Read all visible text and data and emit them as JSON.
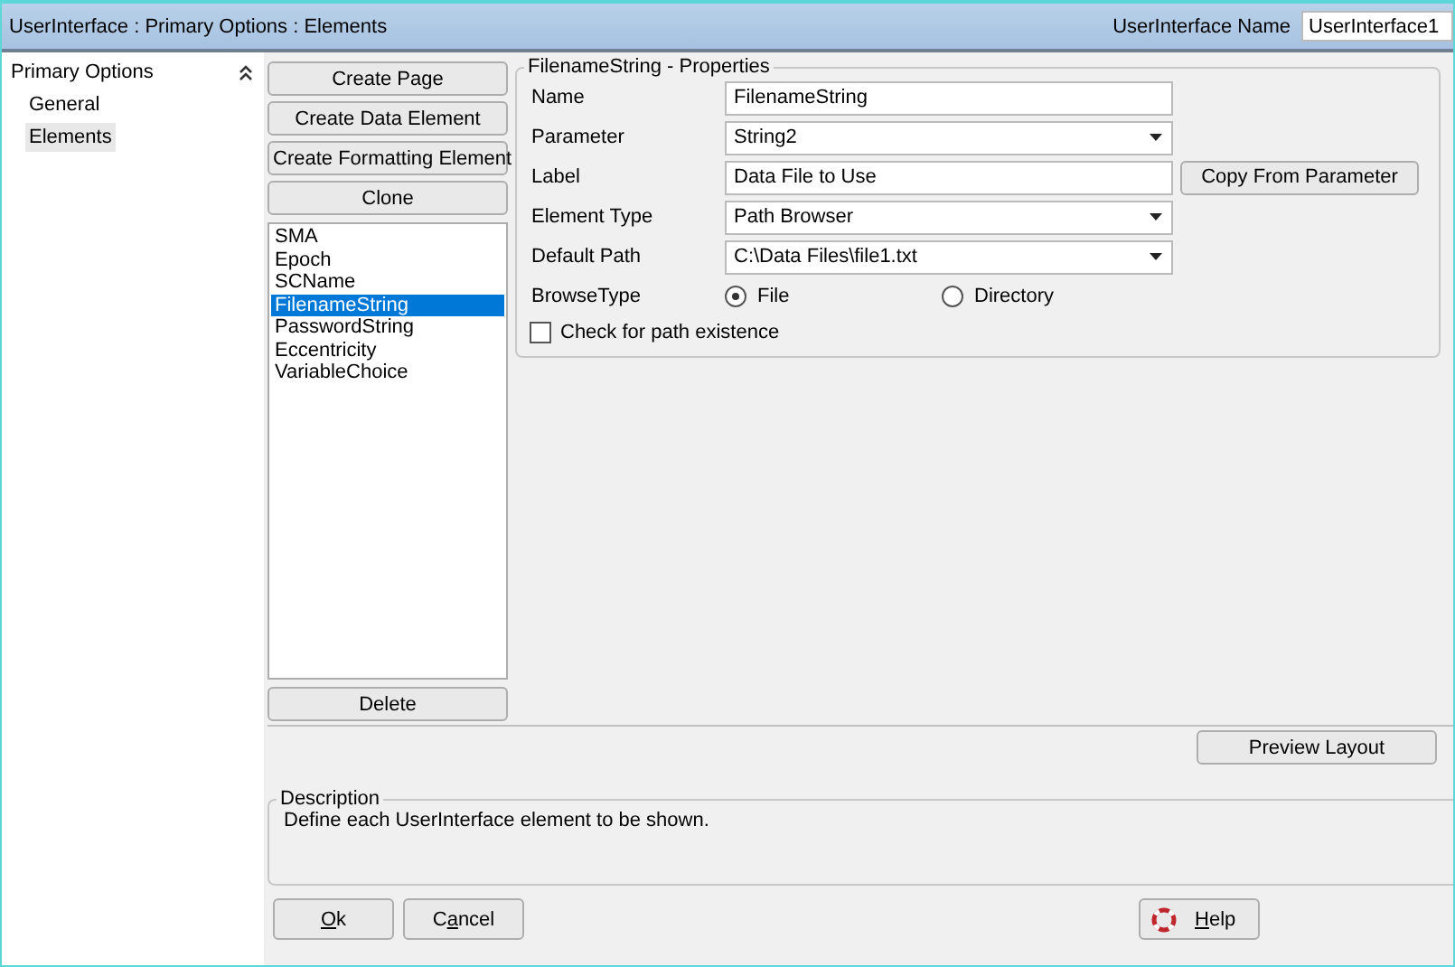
{
  "window": {
    "title": "UserInterface : Primary Options : Elements",
    "name_label": "UserInterface Name",
    "name_value": "UserInterface1"
  },
  "sidebar": {
    "title": "Primary Options",
    "expanded": true,
    "items": [
      {
        "label": "General",
        "selected": false
      },
      {
        "label": "Elements",
        "selected": true
      }
    ]
  },
  "actions": [
    "Create Page",
    "Create Data Element",
    "Create Formatting Element",
    "Clone"
  ],
  "elements": [
    {
      "label": "SMA",
      "selected": false
    },
    {
      "label": "Epoch",
      "selected": false
    },
    {
      "label": "SCName",
      "selected": false
    },
    {
      "label": "FilenameString",
      "selected": true
    },
    {
      "label": "PasswordString",
      "selected": false
    },
    {
      "label": "Eccentricity",
      "selected": false
    },
    {
      "label": "VariableChoice",
      "selected": false
    }
  ],
  "delete_button": "Delete",
  "properties": {
    "title": "FilenameString - Properties",
    "fields": [
      {
        "kind": "text",
        "label": "Name",
        "value": "FilenameString"
      },
      {
        "kind": "combo",
        "label": "Parameter",
        "value": "String2"
      },
      {
        "kind": "text",
        "label": "Label",
        "value": "Data File to Use",
        "button": "Copy From Parameter"
      },
      {
        "kind": "combo",
        "label": "Element Type",
        "value": "Path Browser"
      },
      {
        "kind": "combo",
        "label": "Default Path",
        "value": "C:\\Data Files\\file1.txt"
      },
      {
        "kind": "radio",
        "label": "BrowseType",
        "options": [
          {
            "label": "File",
            "selected": true
          },
          {
            "label": "Directory",
            "selected": false
          }
        ]
      }
    ],
    "check": {
      "label": "Check for path existence",
      "checked": false
    }
  },
  "preview_button": "Preview Layout",
  "description": {
    "title": "Description",
    "text": "Define each UserInterface element to be shown."
  },
  "buttons": [
    {
      "kind": "ok",
      "key": "O",
      "after": "k"
    },
    {
      "kind": "cancel",
      "before": "C",
      "key": "a",
      "after": "ncel"
    },
    {
      "kind": "help",
      "key": "H",
      "after": "elp"
    }
  ]
}
